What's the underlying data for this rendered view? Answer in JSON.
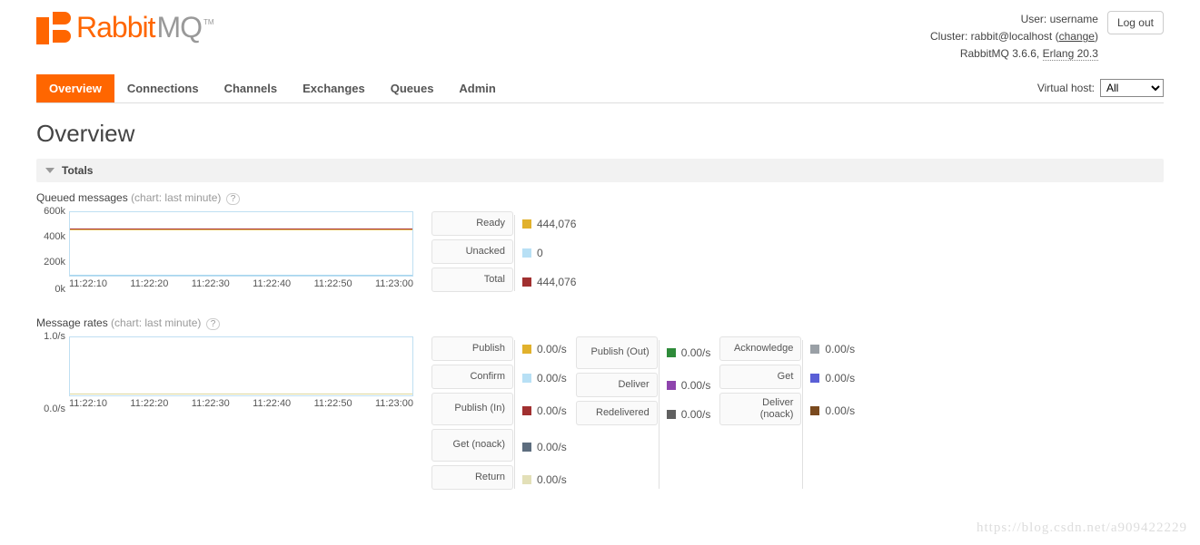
{
  "header": {
    "logo1": "Rabbit",
    "logo2": "MQ",
    "tm": "TM",
    "user_label": "User: ",
    "user": "username",
    "cluster_label": "Cluster: ",
    "cluster": "rabbit@localhost",
    "change": "change",
    "rabbitmq_version": "RabbitMQ 3.6.6",
    "erlang_version": "Erlang 20.3",
    "logout": "Log out"
  },
  "nav": [
    "Overview",
    "Connections",
    "Channels",
    "Exchanges",
    "Queues",
    "Admin"
  ],
  "vhost": {
    "label": "Virtual host:",
    "selected": "All"
  },
  "page": {
    "title": "Overview"
  },
  "totals": {
    "label": "Totals"
  },
  "misc": {
    "help": "?",
    "watermark": "https://blog.csdn.net/a909422229"
  },
  "queued": {
    "title": "Queued messages ",
    "hint": "(chart: last minute) ",
    "legend": [
      {
        "label": "Ready",
        "value": "444,076",
        "sw": "background:#e1b12c"
      },
      {
        "label": "Unacked",
        "value": "0",
        "sw": "background:#b8e0f5"
      },
      {
        "label": "Total",
        "value": "444,076",
        "sw": "background:#a13030"
      }
    ]
  },
  "rates": {
    "title": "Message rates ",
    "hint": "(chart: last minute) ",
    "col1": [
      {
        "label": "Publish",
        "value": "0.00/s",
        "sw": "background:#e1b12c"
      },
      {
        "label": "Confirm",
        "value": "0.00/s",
        "sw": "background:#b8e0f5"
      },
      {
        "label": "Publish (In)",
        "value": "0.00/s",
        "sw": "background:#a13030"
      },
      {
        "label": "Get (noack)",
        "value": "0.00/s",
        "sw": "background:#5d6d7e"
      },
      {
        "label": "Return",
        "value": "0.00/s",
        "sw": "background:#e3e0b8"
      }
    ],
    "col2": [
      {
        "label": "Publish (Out)",
        "value": "0.00/s",
        "sw": "background:#2e8b3a"
      },
      {
        "label": "Deliver",
        "value": "0.00/s",
        "sw": "background:#8e44ad"
      },
      {
        "label": "Redelivered",
        "value": "0.00/s",
        "sw": "background:#606060"
      }
    ],
    "col3": [
      {
        "label": "Acknowledge",
        "value": "0.00/s",
        "sw": "background:#9aa0a6"
      },
      {
        "label": "Get",
        "value": "0.00/s",
        "sw": "background:#5a5fd6"
      },
      {
        "label": "Deliver (noack)",
        "value": "0.00/s",
        "sw": "background:#7a4a1f"
      }
    ]
  },
  "chart_data": [
    {
      "type": "line",
      "title": "Queued messages",
      "yticks": [
        "600k",
        "400k",
        "200k",
        "0k"
      ],
      "ylim": [
        0,
        600000
      ],
      "xticks": [
        "11:22:10",
        "11:22:20",
        "11:22:30",
        "11:22:40",
        "11:22:50",
        "11:23:00"
      ],
      "series": [
        {
          "name": "Ready",
          "color": "#e1b12c",
          "values": [
            444076,
            444076,
            444076,
            444076,
            444076,
            444076
          ]
        },
        {
          "name": "Unacked",
          "color": "#b8e0f5",
          "values": [
            0,
            0,
            0,
            0,
            0,
            0
          ]
        },
        {
          "name": "Total",
          "color": "#a13030",
          "values": [
            444076,
            444076,
            444076,
            444076,
            444076,
            444076
          ]
        }
      ]
    },
    {
      "type": "line",
      "title": "Message rates",
      "yticks": [
        "1.0/s",
        "0.0/s"
      ],
      "ylim": [
        0,
        1
      ],
      "xticks": [
        "11:22:10",
        "11:22:20",
        "11:22:30",
        "11:22:40",
        "11:22:50",
        "11:23:00"
      ],
      "series": [
        {
          "name": "Publish",
          "values": [
            0,
            0,
            0,
            0,
            0,
            0
          ]
        },
        {
          "name": "Confirm",
          "values": [
            0,
            0,
            0,
            0,
            0,
            0
          ]
        },
        {
          "name": "Publish (In)",
          "values": [
            0,
            0,
            0,
            0,
            0,
            0
          ]
        },
        {
          "name": "Get (noack)",
          "values": [
            0,
            0,
            0,
            0,
            0,
            0
          ]
        },
        {
          "name": "Return",
          "values": [
            0,
            0,
            0,
            0,
            0,
            0
          ]
        },
        {
          "name": "Publish (Out)",
          "values": [
            0,
            0,
            0,
            0,
            0,
            0
          ]
        },
        {
          "name": "Deliver",
          "values": [
            0,
            0,
            0,
            0,
            0,
            0
          ]
        },
        {
          "name": "Redelivered",
          "values": [
            0,
            0,
            0,
            0,
            0,
            0
          ]
        },
        {
          "name": "Acknowledge",
          "values": [
            0,
            0,
            0,
            0,
            0,
            0
          ]
        },
        {
          "name": "Get",
          "values": [
            0,
            0,
            0,
            0,
            0,
            0
          ]
        },
        {
          "name": "Deliver (noack)",
          "values": [
            0,
            0,
            0,
            0,
            0,
            0
          ]
        }
      ]
    }
  ]
}
